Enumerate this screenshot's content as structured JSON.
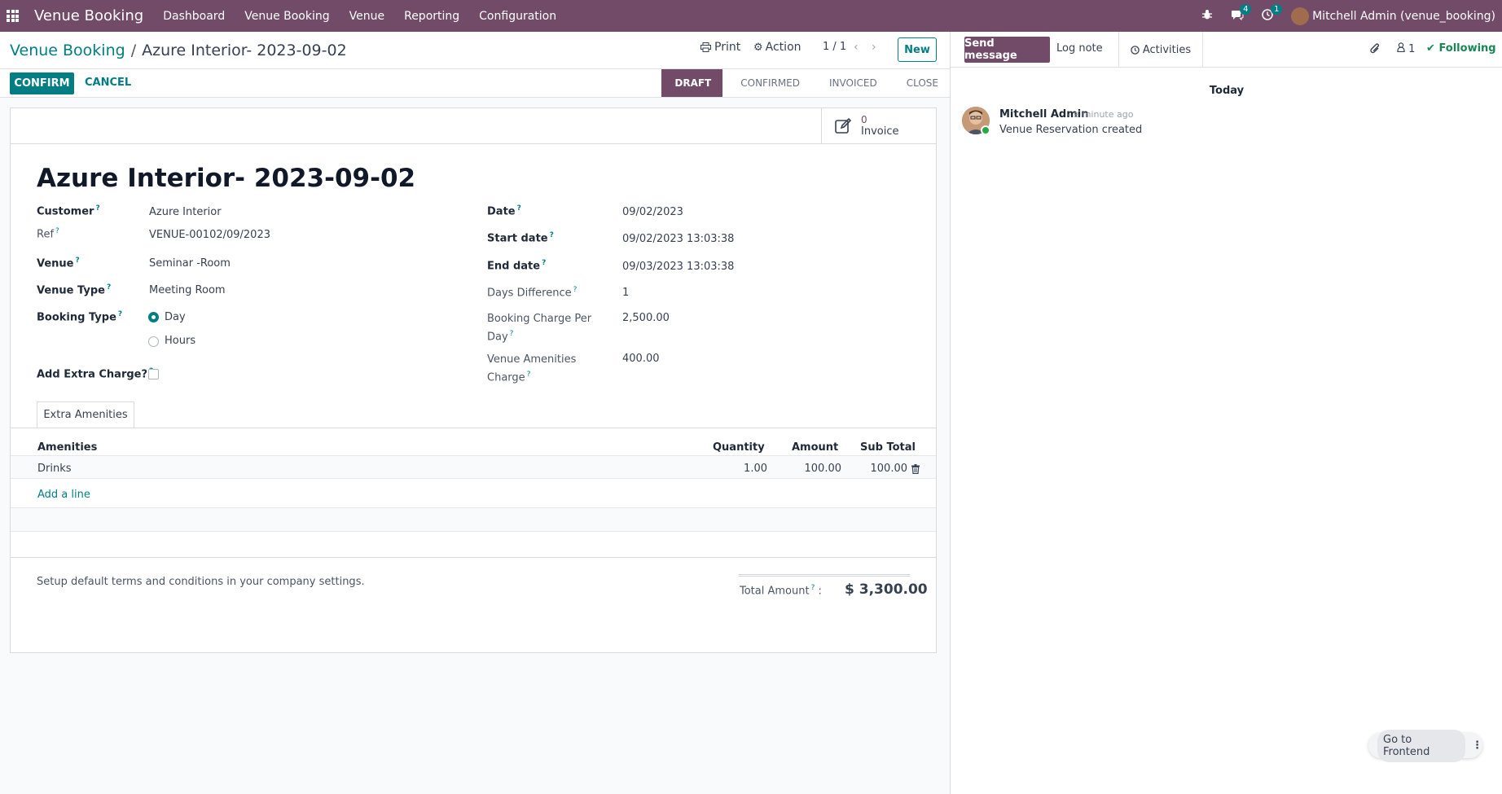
{
  "navbar": {
    "brand": "Venue Booking",
    "menu": [
      "Dashboard",
      "Venue Booking",
      "Venue",
      "Reporting",
      "Configuration"
    ],
    "messages_count": "4",
    "activities_count": "1",
    "user": "Mitchell Admin (venue_booking)"
  },
  "breadcrumb": {
    "parent": "Venue Booking",
    "current": "Azure Interior- 2023-09-02"
  },
  "toolbar": {
    "print": "Print",
    "action": "Action",
    "pager": "1 / 1",
    "new": "New",
    "confirm": "CONFIRM",
    "cancel": "CANCEL"
  },
  "statusbar": {
    "stages": [
      "DRAFT",
      "CONFIRMED",
      "INVOICED",
      "CLOSE"
    ],
    "active": "DRAFT"
  },
  "smart_button": {
    "count": "0",
    "label": "Invoice"
  },
  "record": {
    "title": "Azure Interior- 2023-09-02",
    "labels": {
      "customer": "Customer",
      "ref": "Ref",
      "venue": "Venue",
      "venue_type": "Venue Type",
      "booking_type": "Booking Type",
      "extra_charge": "Add Extra Charge?",
      "date": "Date",
      "start_date": "Start date",
      "end_date": "End date",
      "days_difference": "Days Difference",
      "booking_charge_1": "Booking Charge Per",
      "booking_charge_2": "Day",
      "amenities_charge_1": "Venue Amenities",
      "amenities_charge_2": "Charge"
    },
    "customer": "Azure Interior",
    "ref": "VENUE-00102/09/2023",
    "venue": "Seminar -Room",
    "venue_type": "Meeting Room",
    "booking_type_options": [
      "Day",
      "Hours"
    ],
    "booking_type_selected": "Day",
    "add_extra_charge": false,
    "date": "09/02/2023",
    "start_date": "09/02/2023 13:03:38",
    "end_date": "09/03/2023 13:03:38",
    "days_difference": "1",
    "booking_charge_per_day": "2,500.00",
    "venue_amenities_charge": "400.00"
  },
  "tabs": [
    "Extra Amenities"
  ],
  "amenities_table": {
    "headers": [
      "Amenities",
      "Quantity",
      "Amount",
      "Sub Total"
    ],
    "rows": [
      {
        "amenity": "Drinks",
        "quantity": "1.00",
        "amount": "100.00",
        "subtotal": "100.00"
      }
    ],
    "add_line": "Add a line"
  },
  "footer": {
    "terms": "Setup default terms and conditions in your company settings.",
    "total_label": "Total Amount",
    "total_value": "$ 3,300.00"
  },
  "chatter": {
    "send_message": "Send message",
    "log_note": "Log note",
    "activities": "Activities",
    "followers_count": "1",
    "following": "Following",
    "date_separator": "Today",
    "messages": [
      {
        "author": "Mitchell Admin",
        "time": "- a minute ago",
        "body": "Venue Reservation created"
      }
    ]
  },
  "floating": {
    "go_to_frontend": "Go to Frontend"
  },
  "colors": {
    "brand": "#714b67",
    "accent": "#017e84",
    "following": "#198754"
  }
}
